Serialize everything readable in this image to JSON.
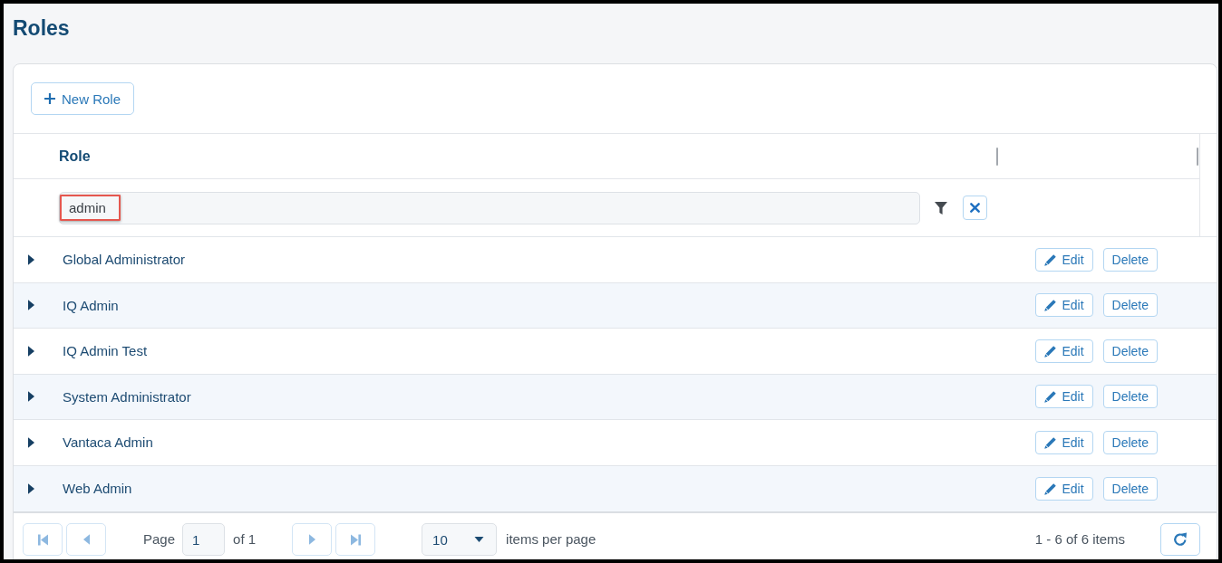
{
  "page": {
    "title": "Roles"
  },
  "toolbar": {
    "new_button": {
      "label": "New Role"
    }
  },
  "table": {
    "columns": [
      {
        "label": "Role"
      }
    ],
    "filter": {
      "value": "admin",
      "highlighted": true
    },
    "rows": [
      {
        "name": "Global Administrator",
        "expanded": false,
        "actions": [
          {
            "kind": "edit",
            "label": "Edit"
          },
          {
            "kind": "delete",
            "label": "Delete"
          }
        ]
      },
      {
        "name": "IQ Admin",
        "expanded": false,
        "actions": [
          {
            "kind": "edit",
            "label": "Edit"
          },
          {
            "kind": "delete",
            "label": "Delete"
          }
        ]
      },
      {
        "name": "IQ Admin Test",
        "expanded": false,
        "actions": [
          {
            "kind": "edit",
            "label": "Edit"
          },
          {
            "kind": "delete",
            "label": "Delete"
          }
        ]
      },
      {
        "name": "System Administrator",
        "expanded": false,
        "actions": [
          {
            "kind": "edit",
            "label": "Edit"
          },
          {
            "kind": "delete",
            "label": "Delete"
          }
        ]
      },
      {
        "name": "Vantaca Admin",
        "expanded": false,
        "actions": [
          {
            "kind": "edit",
            "label": "Edit"
          },
          {
            "kind": "delete",
            "label": "Delete"
          }
        ]
      },
      {
        "name": "Web Admin",
        "expanded": false,
        "actions": [
          {
            "kind": "edit",
            "label": "Edit"
          },
          {
            "kind": "delete",
            "label": "Delete"
          }
        ]
      }
    ]
  },
  "pager": {
    "nav_buttons": [
      {
        "kind": "first",
        "disabled": true
      },
      {
        "kind": "previous",
        "disabled": true
      },
      {
        "kind": "next",
        "disabled": true
      },
      {
        "kind": "last",
        "disabled": true
      }
    ],
    "page_label": "Page",
    "page_value": "1",
    "page_count": "of 1",
    "page_size": "10",
    "page_size_label": "items per page",
    "summary": "1 - 6 of 6 items"
  }
}
